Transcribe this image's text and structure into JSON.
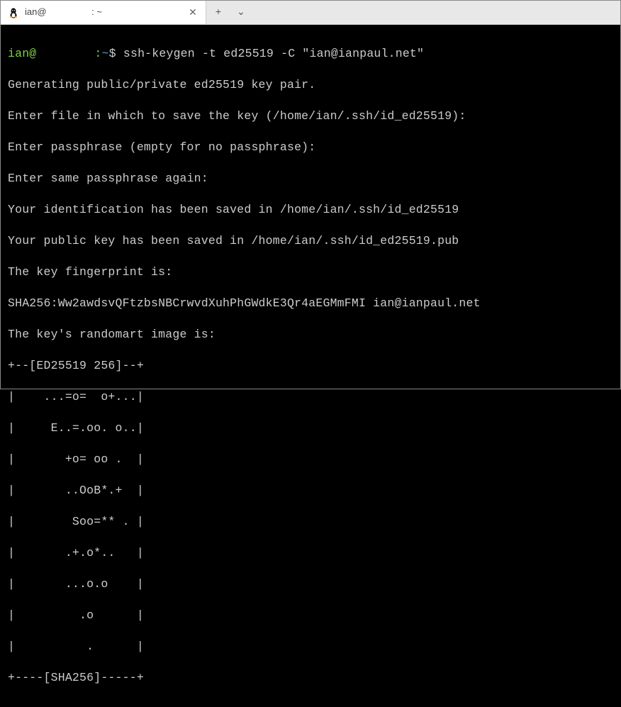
{
  "titlebar": {
    "tab": {
      "title_prefix": "ian@",
      "title_suffix": " : ~",
      "close_glyph": "✕"
    },
    "new_tab_glyph": "+",
    "dropdown_glyph": "⌄"
  },
  "prompt": {
    "user_prefix": "ian@",
    "colon": ":",
    "path": "~",
    "dollar": "$"
  },
  "command": "ssh-keygen -t ed25519 -C \"ian@ianpaul.net\"",
  "output": {
    "l1": "Generating public/private ed25519 key pair.",
    "l2": "Enter file in which to save the key (/home/ian/.ssh/id_ed25519):",
    "l3": "Enter passphrase (empty for no passphrase):",
    "l4": "Enter same passphrase again:",
    "l5": "Your identification has been saved in /home/ian/.ssh/id_ed25519",
    "l6": "Your public key has been saved in /home/ian/.ssh/id_ed25519.pub",
    "l7": "The key fingerprint is:",
    "l8": "SHA256:Ww2awdsvQFtzbsNBCrwvdXuhPhGWdkE3Qr4aEGMmFMI ian@ianpaul.net",
    "l9": "The key's randomart image is:",
    "r0": "+--[ED25519 256]--+",
    "r1": "|    ...=o=  o+...|",
    "r2": "|     E..=.oo. o..|",
    "r3": "|       +o= oo .  |",
    "r4": "|       ..OoB*.+  |",
    "r5": "|        Soo=** . |",
    "r6": "|       .+.o*..   |",
    "r7": "|       ...o.o    |",
    "r8": "|         .o      |",
    "r9": "|          .      |",
    "r10": "+----[SHA256]-----+"
  }
}
